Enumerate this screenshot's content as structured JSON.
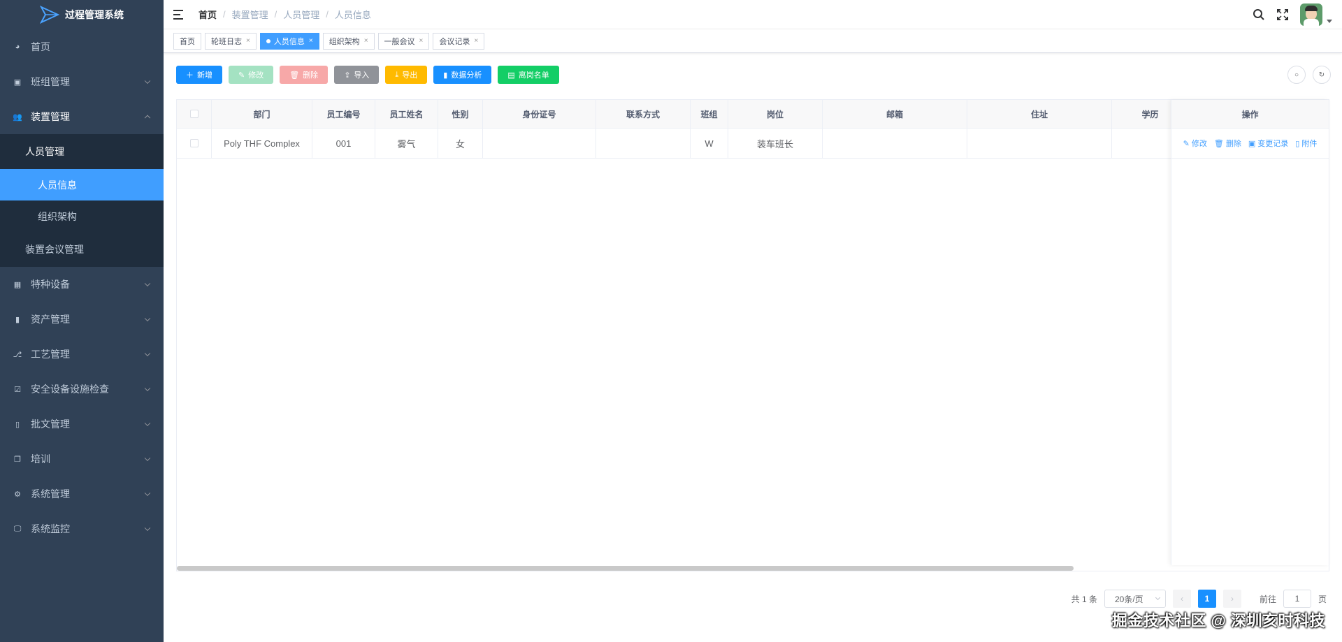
{
  "app": {
    "title": "过程管理系统"
  },
  "sidebar": {
    "items": [
      {
        "label": "首页",
        "icon": "dashboard-icon"
      },
      {
        "label": "班组管理",
        "icon": "team-icon"
      },
      {
        "label": "装置管理",
        "icon": "user-group-icon"
      },
      {
        "label": "特种设备",
        "icon": "grid-icon"
      },
      {
        "label": "资产管理",
        "icon": "bar-chart-icon"
      },
      {
        "label": "工艺管理",
        "icon": "process-icon"
      },
      {
        "label": "安全设备设施检查",
        "icon": "checkbox-icon"
      },
      {
        "label": "批文管理",
        "icon": "book-icon"
      },
      {
        "label": "培训",
        "icon": "copy-icon"
      },
      {
        "label": "系统管理",
        "icon": "gear-icon"
      },
      {
        "label": "系统监控",
        "icon": "monitor-icon"
      }
    ],
    "sub": {
      "personnel": "人员管理",
      "personnel_info": "人员信息",
      "org": "组织架构",
      "meeting": "装置会议管理"
    }
  },
  "breadcrumb": [
    "首页",
    "装置管理",
    "人员管理",
    "人员信息"
  ],
  "tags": [
    {
      "label": "首页",
      "closable": false,
      "active": false
    },
    {
      "label": "轮班日志",
      "closable": true,
      "active": false
    },
    {
      "label": "人员信息",
      "closable": true,
      "active": true
    },
    {
      "label": "组织架构",
      "closable": true,
      "active": false
    },
    {
      "label": "一般会议",
      "closable": true,
      "active": false
    },
    {
      "label": "会议记录",
      "closable": true,
      "active": false
    }
  ],
  "toolbar": {
    "add": "新增",
    "edit": "修改",
    "delete": "删除",
    "import": "导入",
    "export": "导出",
    "analysis": "数据分析",
    "roster": "离岗名单"
  },
  "table": {
    "headers": [
      "部门",
      "员工编号",
      "员工姓名",
      "性别",
      "身份证号",
      "联系方式",
      "班组",
      "岗位",
      "邮箱",
      "住址",
      "学历"
    ],
    "action_header": "操作",
    "rows": [
      {
        "dept": "Poly THF Complex",
        "id": "001",
        "name": "雾气",
        "gender": "女",
        "idcard": "",
        "phone": "",
        "team": "W",
        "post": "装车班长",
        "email": "",
        "address": "",
        "edu": ""
      }
    ],
    "actions": {
      "edit": "修改",
      "delete": "删除",
      "history": "变更记录",
      "attach": "附件"
    }
  },
  "pagination": {
    "total": "共 1 条",
    "page_size": "20条/页",
    "current": "1",
    "goto_prefix": "前往",
    "goto_value": "1",
    "goto_suffix": "页"
  },
  "watermark": "掘金技术社区 @ 深圳亥时科技",
  "colors": {
    "sidebar": "#304156",
    "primary": "#1890ff",
    "active_menu": "#409eff"
  }
}
